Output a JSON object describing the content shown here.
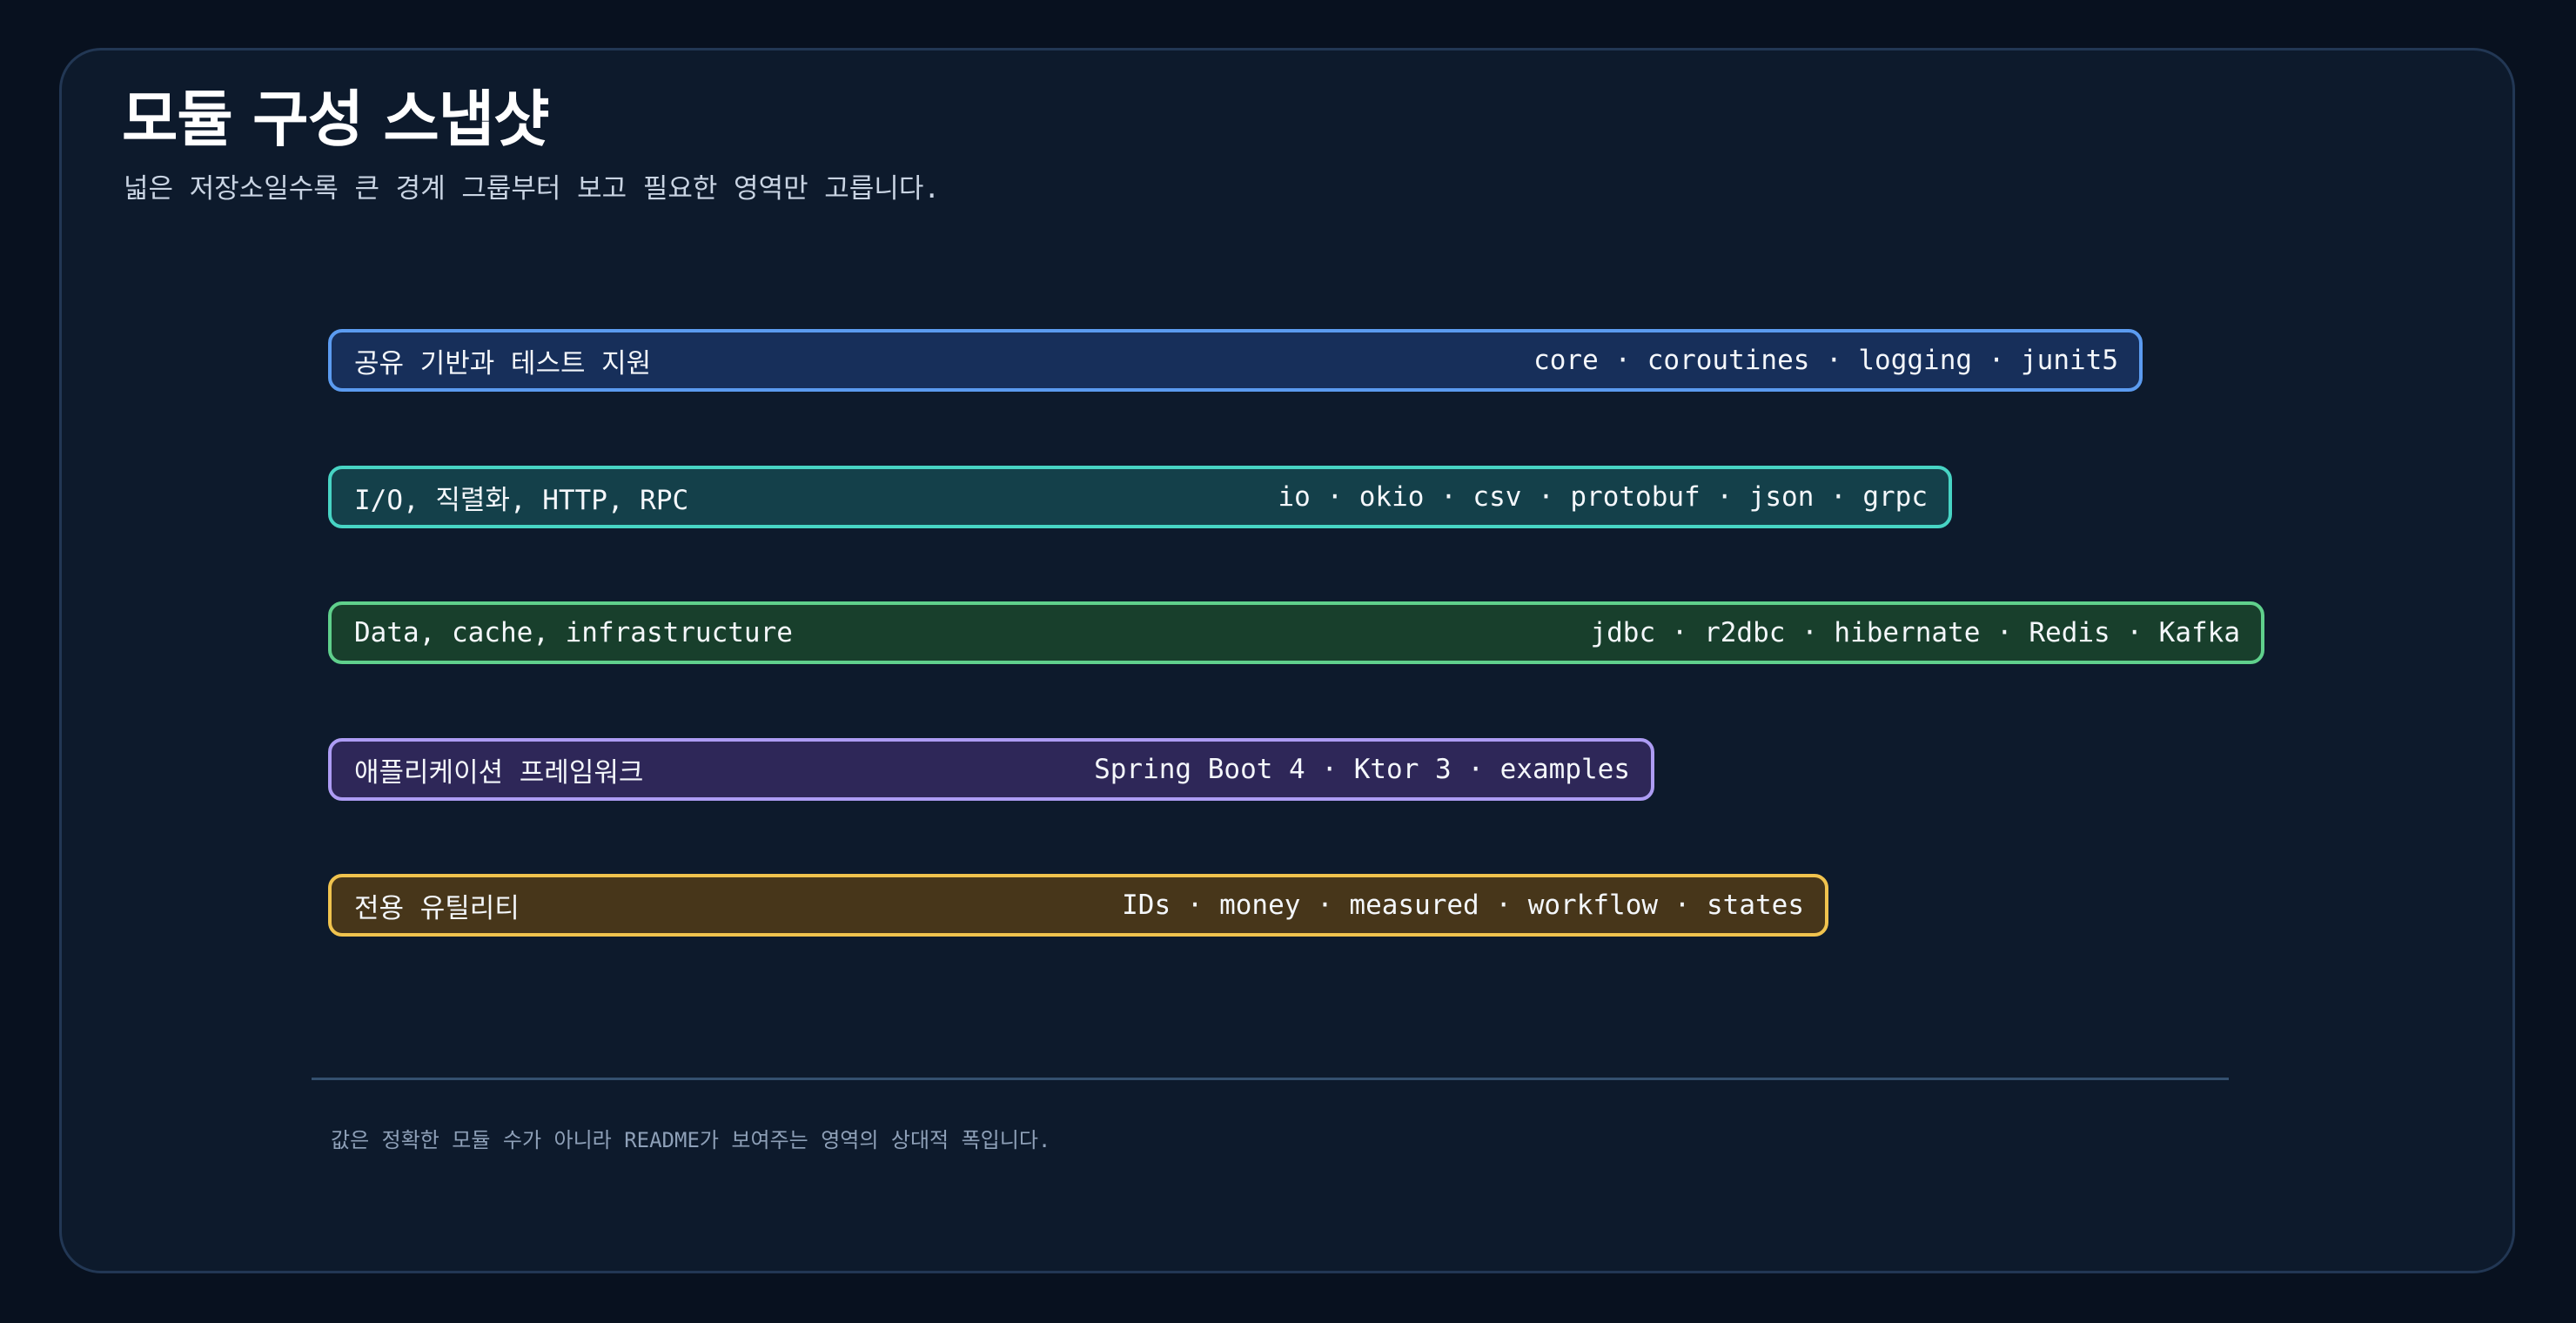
{
  "header": {
    "title": "모듈 구성 스냅샷",
    "subtitle": "넓은 저장소일수록 큰 경계 그룹부터 보고 필요한 영역만 고릅니다."
  },
  "groups": [
    {
      "label": "공유 기반과 테스트 지원",
      "modules": "core · coroutines · logging · junit5",
      "relative_width": 0.9373,
      "fill": "#172f5a",
      "border": "#5b9bf0"
    },
    {
      "label": "I/O, 직렬화, HTTP, RPC",
      "modules": "io · okio · csv · protobuf · json · grpc",
      "relative_width": 0.8386,
      "fill": "#14404a",
      "border": "#47d4c4"
    },
    {
      "label": "Data, cache, infrastructure",
      "modules": "jdbc · r2dbc · hibernate · Redis · Kafka",
      "relative_width": 1.0,
      "fill": "#183f2c",
      "border": "#5fd08c"
    },
    {
      "label": "애플리케이션 프레임워크",
      "modules": "Spring Boot 4 · Ktor 3 · examples",
      "relative_width": 0.6848,
      "fill": "#2e2758",
      "border": "#ad9cf4"
    },
    {
      "label": "전용 유틸리티",
      "modules": "IDs · money · measured · workflow · states",
      "relative_width": 0.7749,
      "fill": "#47361a",
      "border": "#f0c34e"
    }
  ],
  "footnote": "값은 정확한 모듈 수가 아니라 README가 보여주는 영역의 상대적 폭입니다."
}
